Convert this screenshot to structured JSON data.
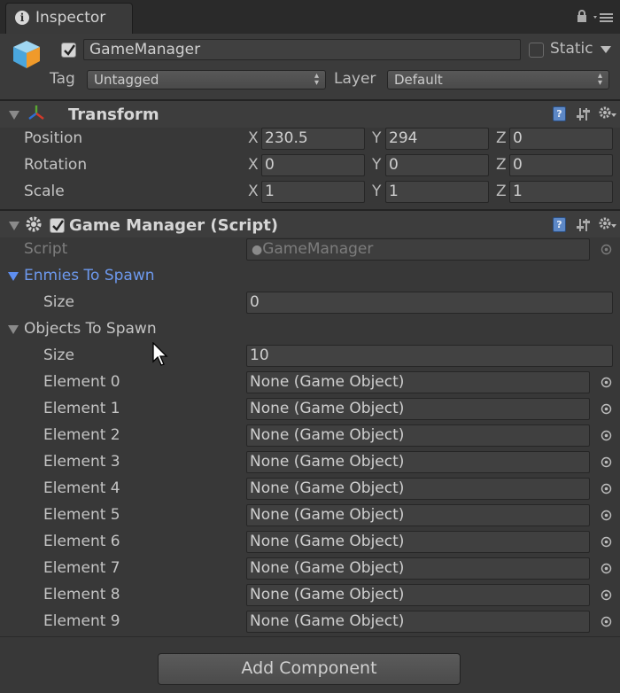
{
  "tab": {
    "title": "Inspector"
  },
  "object": {
    "name": "GameManager",
    "active": true,
    "static_label": "Static",
    "static_checked": false,
    "tag_label": "Tag",
    "tag_value": "Untagged",
    "layer_label": "Layer",
    "layer_value": "Default"
  },
  "transform": {
    "title": "Transform",
    "rows": [
      {
        "label": "Position",
        "x": "230.5",
        "y": "294",
        "z": "0"
      },
      {
        "label": "Rotation",
        "x": "0",
        "y": "0",
        "z": "0"
      },
      {
        "label": "Scale",
        "x": "1",
        "y": "1",
        "z": "1"
      }
    ],
    "axis_x": "X",
    "axis_y": "Y",
    "axis_z": "Z"
  },
  "script_component": {
    "title": "Game Manager (Script)",
    "enabled": true,
    "script_label": "Script",
    "script_value": "GameManager",
    "enemies": {
      "label": "Enmies To Spawn",
      "size_label": "Size",
      "size": "0"
    },
    "objects": {
      "label": "Objects To Spawn",
      "size_label": "Size",
      "size": "10",
      "elements": [
        {
          "label": "Element 0",
          "value": "None (Game Object)"
        },
        {
          "label": "Element 1",
          "value": "None (Game Object)"
        },
        {
          "label": "Element 2",
          "value": "None (Game Object)"
        },
        {
          "label": "Element 3",
          "value": "None (Game Object)"
        },
        {
          "label": "Element 4",
          "value": "None (Game Object)"
        },
        {
          "label": "Element 5",
          "value": "None (Game Object)"
        },
        {
          "label": "Element 6",
          "value": "None (Game Object)"
        },
        {
          "label": "Element 7",
          "value": "None (Game Object)"
        },
        {
          "label": "Element 8",
          "value": "None (Game Object)"
        },
        {
          "label": "Element 9",
          "value": "None (Game Object)"
        }
      ]
    }
  },
  "add_component": {
    "label": "Add Component"
  },
  "colors": {
    "background": "#383838",
    "accent_blue": "#6d99ee"
  }
}
